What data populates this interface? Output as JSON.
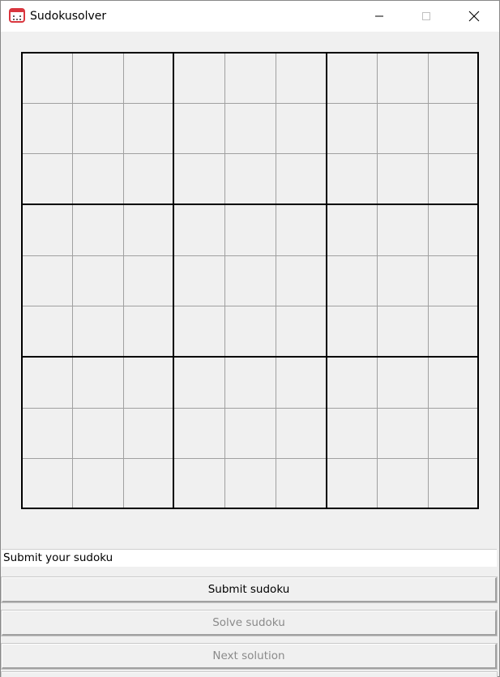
{
  "window": {
    "title": "Sudokusolver",
    "controls": {
      "minimize_icon": "minimize-icon",
      "maximize_icon": "maximize-icon",
      "close_icon": "close-icon"
    }
  },
  "board": {
    "size": 9,
    "block_size": 3,
    "cells": [
      [
        "",
        "",
        "",
        "",
        "",
        "",
        "",
        "",
        ""
      ],
      [
        "",
        "",
        "",
        "",
        "",
        "",
        "",
        "",
        ""
      ],
      [
        "",
        "",
        "",
        "",
        "",
        "",
        "",
        "",
        ""
      ],
      [
        "",
        "",
        "",
        "",
        "",
        "",
        "",
        "",
        ""
      ],
      [
        "",
        "",
        "",
        "",
        "",
        "",
        "",
        "",
        ""
      ],
      [
        "",
        "",
        "",
        "",
        "",
        "",
        "",
        "",
        ""
      ],
      [
        "",
        "",
        "",
        "",
        "",
        "",
        "",
        "",
        ""
      ],
      [
        "",
        "",
        "",
        "",
        "",
        "",
        "",
        "",
        ""
      ],
      [
        "",
        "",
        "",
        "",
        "",
        "",
        "",
        "",
        ""
      ]
    ],
    "colors": {
      "background": "#f0f0f0",
      "thin_line": "#a0a0a0",
      "thick_line": "#000000"
    }
  },
  "status": {
    "text": "Submit your sudoku"
  },
  "buttons": {
    "submit_label": "Submit sudoku",
    "solve_label": "Solve sudoku",
    "next_label": "Next solution",
    "submit_enabled": true,
    "solve_enabled": false,
    "next_enabled": false
  }
}
